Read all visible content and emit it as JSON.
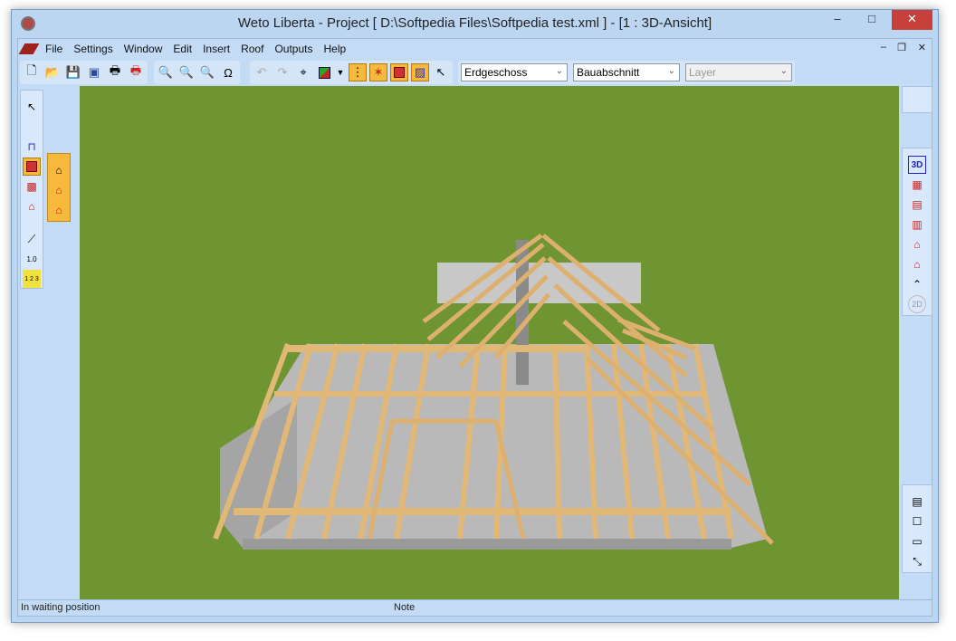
{
  "window": {
    "title": "Weto Liberta - Project [ D:\\Softpedia Files\\Softpedia test.xml ]  - [1 : 3D-Ansicht]"
  },
  "menu": {
    "items": [
      "File",
      "Settings",
      "Window",
      "Edit",
      "Insert",
      "Roof",
      "Outputs",
      "Help"
    ]
  },
  "toolbar": {
    "icons": [
      "new-icon",
      "open-icon",
      "save-icon",
      "save-all-icon",
      "print-icon",
      "print-pdf-icon",
      "zoom-in-icon",
      "zoom-out-icon",
      "zoom-window-icon",
      "zoom-text-icon",
      "undo-icon",
      "redo-icon",
      "crosshair-icon",
      "3d-cube-icon",
      "dropdown-arrow-icon",
      "wall-layout-icon",
      "roof-star-icon",
      "roof-red-icon",
      "hatch-icon",
      "pointer-icon"
    ],
    "floor_select": "Erdgeschoss",
    "section_select": "Bauabschnitt",
    "layer_select": "Layer"
  },
  "left_toolbar": {
    "icons": [
      "pointer-icon",
      "wall-icon",
      "roof-corner-icon",
      "hatch-square-icon",
      "house-icon",
      "line-icon",
      "dimension-icon",
      "ruler-icon"
    ],
    "dimension_label": "1.0",
    "ruler_label": "1 2 3"
  },
  "roof_toolbar": {
    "icons": [
      "roof-edit-icon",
      "roof-red-icon",
      "roof-down-icon"
    ]
  },
  "right_toolbar": {
    "view_3d": "3D",
    "view_2d": "2D",
    "icons": [
      "3d-view-icon",
      "floor-plan-icon",
      "section-icon",
      "elevation-icon",
      "house-front-icon",
      "house-side-icon",
      "roof-outline-icon",
      "2d-view-icon"
    ],
    "bottom_icons": [
      "table-icon",
      "window-normal-icon",
      "window-min-icon",
      "window-restore-icon"
    ]
  },
  "status": {
    "left": "In waiting position",
    "note": "Note"
  },
  "colors": {
    "grass": "#6f9432",
    "timber": "#e2b877",
    "slab": "#bdbdbd",
    "active": "#f6b93c"
  }
}
